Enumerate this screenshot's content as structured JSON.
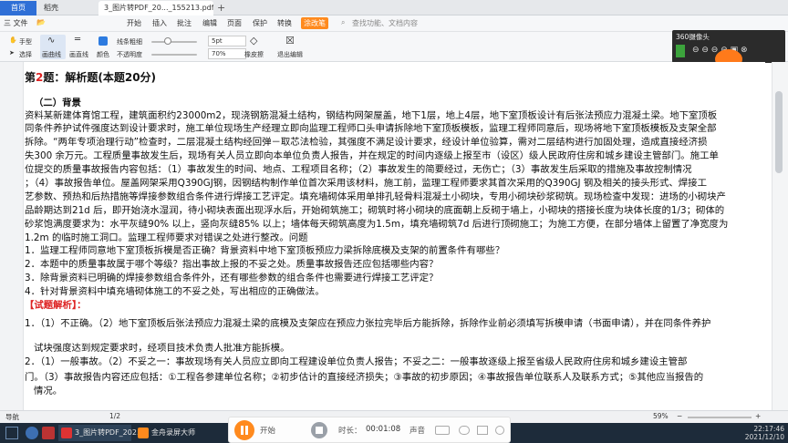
{
  "tabs": {
    "home": "首页",
    "t2": "稻壳",
    "t3": "3_图片转PDF_20..._155213.pdf",
    "plus": "+"
  },
  "menu": {
    "file": "三 文件",
    "open_icon": "📂",
    "items": [
      "开始",
      "插入",
      "批注",
      "编辑",
      "页面",
      "保护",
      "转换",
      "涂改笔"
    ],
    "search": "查找功能、文档内容"
  },
  "toolbar": {
    "hand": "手型",
    "select": "选择",
    "pen": "画曲线",
    "straight": "画直线",
    "color": "颜色",
    "thickness": "线条粗细",
    "opacity": "不透明度",
    "size_value": "5pt",
    "opacity_value": "70%",
    "eraser": "橡皮擦",
    "exit": "退出编辑",
    "thickness_fraction": 0.35,
    "opacity_fraction": 0.7
  },
  "recorder_panel": {
    "title": "360摄像头"
  },
  "doc": {
    "heading_prefix": "第",
    "heading_num": "2",
    "heading_rest": "题：解析题(本题20分)",
    "lines": [
      "（二）背景",
      "资料某新建体育馆工程，建筑面积约23000m2，现浇钢筋混凝土结构，钢结构网架屋盖，地下1层，地上4层，地下室顶板设计有后张法预应力混凝土梁。地下室顶板",
      "同条件养护试件强度达到设计要求时，施工单位现场生产经理立即向监理工程师口头申请拆除地下室顶板模板，监理工程师同意后，现场将地下室顶板模板及支架全部",
      "拆除。“两年专项治理行动”检查时，二层混凝土结构经回弹－取芯法检验，其强度不满足设计要求，经设计单位验算，需对二层结构进行加固处理，造成直接经济损",
      "失300 余万元。工程质量事故发生后，现场有关人员立即向本单位负责人报告，并在规定的时间内逐级上报至市（设区）级人民政府住房和城乡建设主管部门。施工单",
      "位提交的质量事故报告内容包括：（1）事故发生的时间、地点、工程项目名称；（2）事故发生的简要经过，无伤亡；（3）事故发生后采取的措施及事故控制情况",
      "；（4）事故报告单位。屋盖网架采用Q390GJ钢，因钢结构制作单位首次采用该材料，施工前，监理工程师要求其首次采用的Q390GJ 钢及相关的接头形式、焊接工",
      "艺参数、预热和后热措施等焊接参数组合条件进行焊接工艺评定。填充墙砌体采用单排孔轻骨料混凝土小砌块，专用小砌块砂浆砌筑。现场检查中发现：进场的小砌块产",
      "品龄期达到21d 后，即开始浇水湿润，待小砌块表面出现浮水后，开始砌筑施工；砌筑时将小砌块的底面朝上反砌于墙上，小砌块的搭接长度为块体长度的1/3；砌体的",
      "砂浆饱满度要求为：水平灰缝90% 以上，竖向灰缝85% 以上；墙体每天砌筑高度为1.5m，填充墙砌筑7d 后进行顶砌施工；为施工方便，在部分墙体上留置了净宽度为",
      "1.2m 的临时施工洞口。监理工程师要求对错误之处进行整改。问题",
      "1．监理工程师同意地下室顶板拆模是否正确？背景资料中地下室顶板预应力梁拆除底模及支架的前置条件有哪些？",
      "2．本题中的质量事故属于哪个等级？指出事故上报的不妥之处。质量事故报告还应包括哪些内容？",
      "3．除背景资料已明确的焊接参数组合条件外，还有哪些参数的组合条件也需要进行焊接工艺评定？",
      "4．针对背景资料中填充墙砌体施工的不妥之处，写出相应的正确做法。",
      "【试题解析】：",
      "1．（1）不正确。（2）地下室顶板后张法预应力混凝土梁的底模及支架应在预应力张拉完毕后方能拆除，拆除作业前必须填写拆模申请（书面申请），并在同条件养护",
      "试块强度达到规定要求时，经项目技术负责人批准方能拆模。",
      "2．（1）一般事故。（2）不妥之一：事故现场有关人员应立即向工程建设单位负责人报告；不妥之二：一般事故逐级上报至省级人民政府住房和城乡建设主管部",
      "门。（3）事故报告内容还应包括：①工程各参建单位名称；②初步估计的直接经济损失；③事故的初步原因；④事故报告单位联系人及联系方式；⑤其他应当报告的",
      "情况。"
    ]
  },
  "status": {
    "nav": "导航",
    "page": "1/2",
    "zoom": "59%",
    "zoom_minus": "−",
    "zoom_plus": "+"
  },
  "taskbar": {
    "item1": "3_图片转PDF_202...",
    "item2": "金舟录屏大师",
    "time": "22:17:46",
    "date": "2021/12/10"
  },
  "recbar": {
    "start": "开始",
    "duration_label": "时长：",
    "duration": "00:01:08",
    "sound": "声音"
  },
  "colors": {
    "accent": "#2f6fd6",
    "orange": "#ff8a1e",
    "red": "#d22"
  }
}
